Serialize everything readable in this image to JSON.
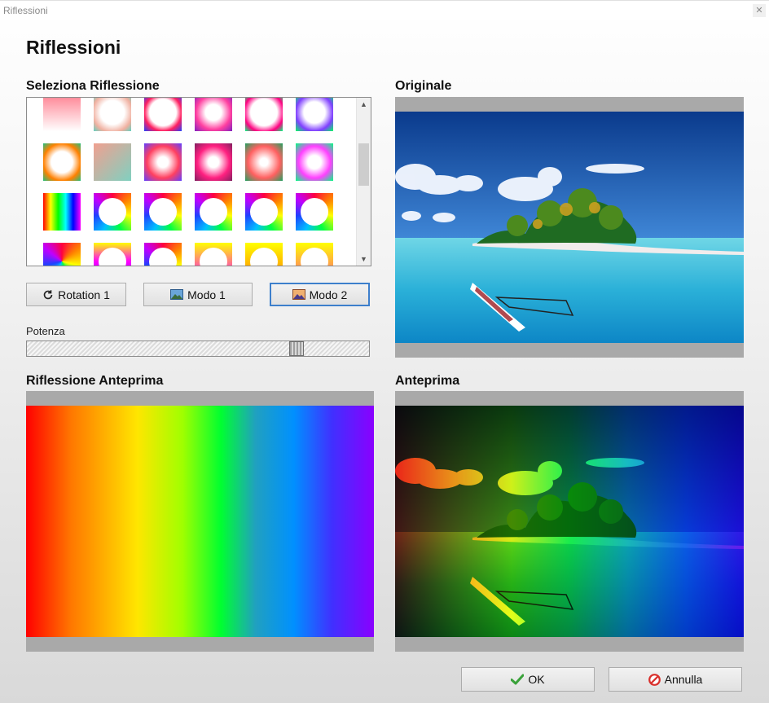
{
  "window": {
    "title": "Riflessioni",
    "close_glyph": "✕"
  },
  "heading": "Riflessioni",
  "sections": {
    "select_reflection": "Seleziona Riflessione",
    "original": "Originale",
    "reflection_preview": "Riflessione Anteprima",
    "preview": "Anteprima"
  },
  "buttons": {
    "rotation": {
      "label": "Rotation 1",
      "icon": "rotate-icon"
    },
    "mode1": {
      "label": "Modo 1",
      "icon": "image-icon"
    },
    "mode2": {
      "label": "Modo 2",
      "icon": "image-icon"
    },
    "ok": {
      "label": "OK",
      "icon": "checkmark-icon"
    },
    "cancel": {
      "label": "Annulla",
      "icon": "cancel-icon"
    }
  },
  "power": {
    "label": "Potenza",
    "value_fraction": 0.8
  },
  "gallery": {
    "rows": 4,
    "columns": 6,
    "selected_mode": "Modo 2"
  },
  "colors": {
    "accent": "#3d7fcc",
    "pane_bg": "#a9a9a9"
  }
}
